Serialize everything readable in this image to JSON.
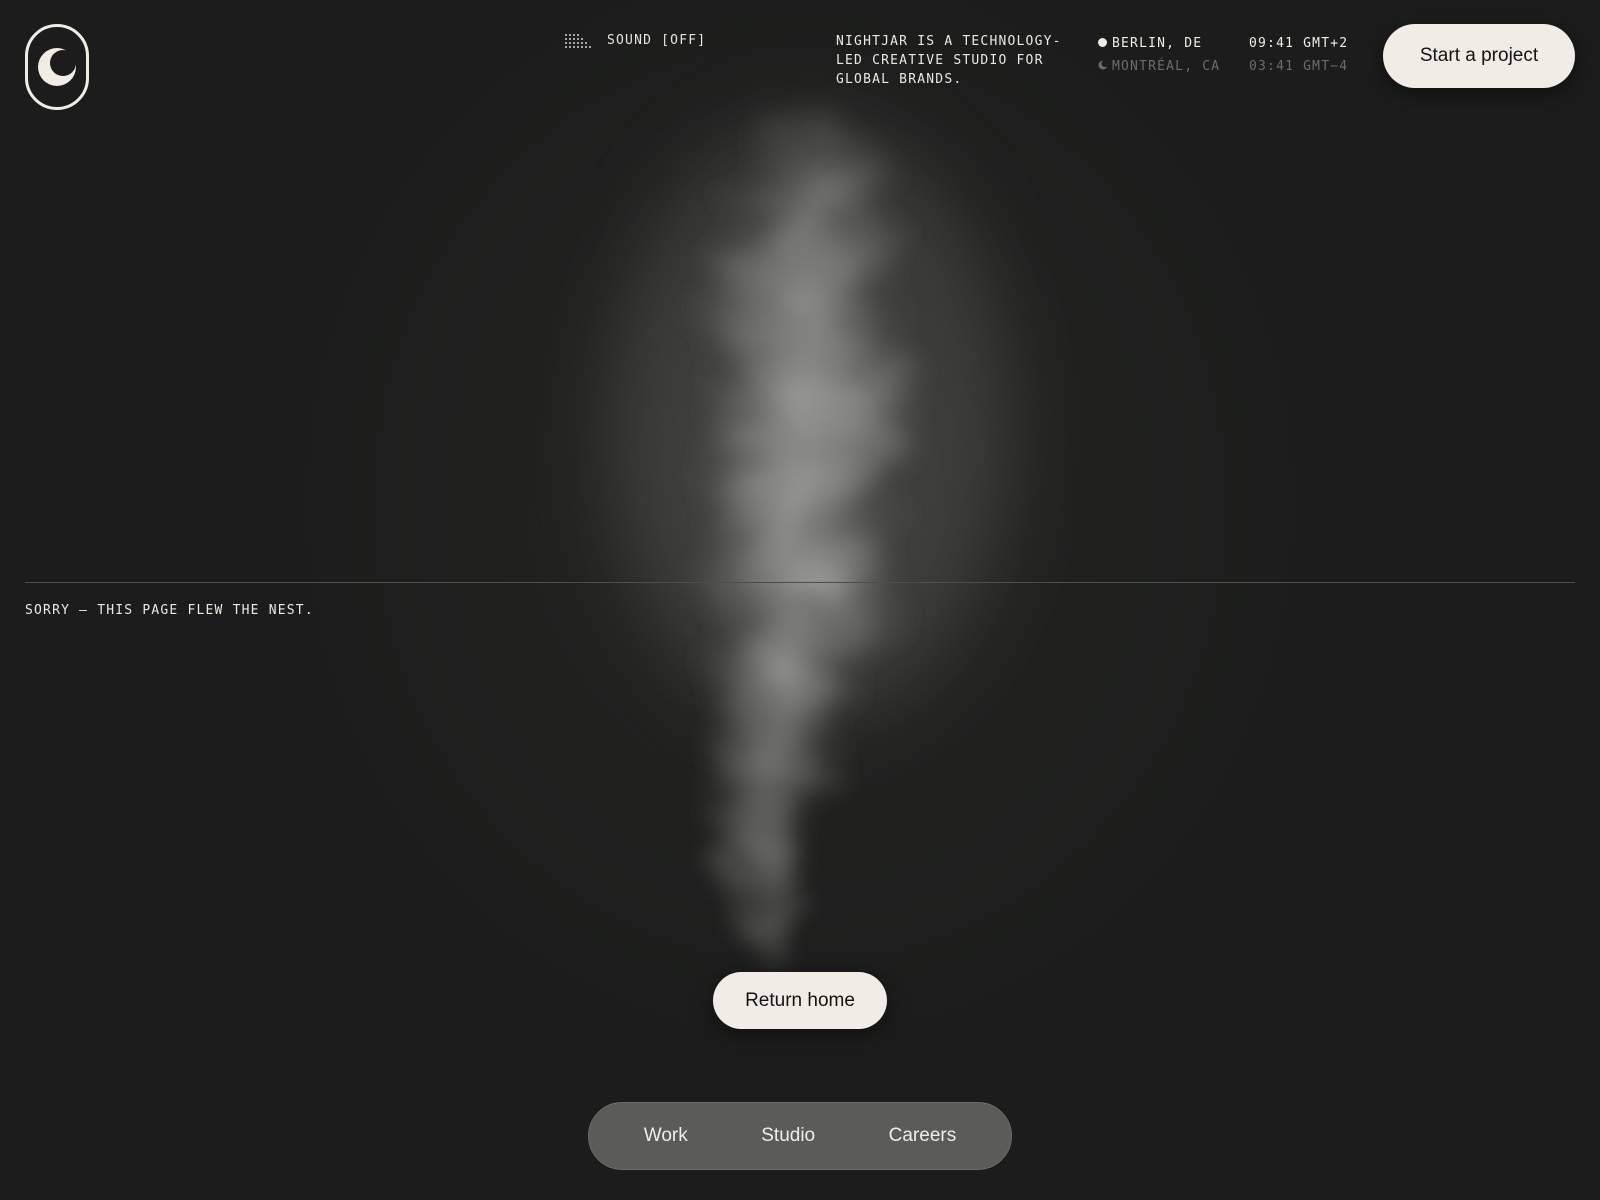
{
  "brand": {
    "logo_icon": "crescent-moon-logo"
  },
  "header": {
    "sound": {
      "icon": "sound-bars-icon",
      "label": "SOUND [OFF]"
    },
    "tagline": "NIGHTJAR IS A TECHNOLOGY-LED CREATIVE STUDIO FOR GLOBAL BRANDS.",
    "locations": [
      {
        "city": "BERLIN, DE",
        "time": "09:41 GMT+2",
        "icon": "sun-dot-icon",
        "active": true
      },
      {
        "city": "MONTRÉAL, CA",
        "time": "03:41 GMT−4",
        "icon": "moon-icon",
        "active": false
      }
    ],
    "cta_label": "Start a project"
  },
  "main": {
    "message": "SORRY — THIS PAGE FLEW THE NEST.",
    "return_label": "Return home"
  },
  "nav": {
    "items": [
      {
        "label": "Work"
      },
      {
        "label": "Studio"
      },
      {
        "label": "Careers"
      }
    ]
  },
  "colors": {
    "background": "#1b1c1b",
    "cream": "#f1ede4",
    "nav_pill": "#5b5b58",
    "dim_text": "#6c6c68"
  }
}
